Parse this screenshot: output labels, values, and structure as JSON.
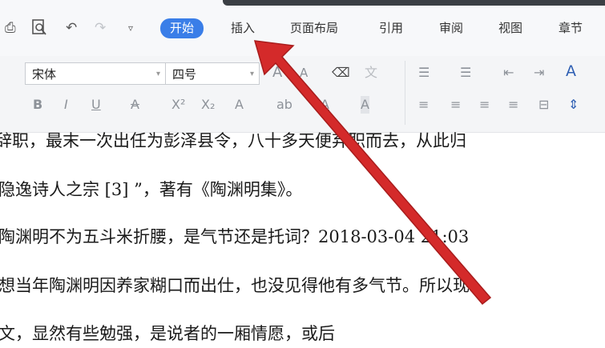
{
  "quick_access": {
    "print_icon": "printer-icon",
    "preview_icon": "print-preview-icon",
    "undo_icon": "undo-icon",
    "redo_icon": "redo-icon",
    "more_icon": "customize-icon"
  },
  "menu": {
    "tabs": [
      "开始",
      "插入",
      "页面布局",
      "引用",
      "审阅",
      "视图",
      "章节"
    ],
    "active_tab": "开始"
  },
  "ribbon": {
    "font_name": "宋体",
    "font_size": "四号",
    "format_buttons": [
      "B",
      "I",
      "U",
      "A",
      "X²",
      "X₂",
      "A",
      "ab",
      "A",
      "A"
    ],
    "grow_font": "A",
    "shrink_font": "A",
    "phonetic": "文",
    "style_a": "A"
  },
  "document": {
    "lines": [
      "辞职，最末一次出任为彭泽县令，八十多天便弃职而去，从此归",
      "隐逸诗人之宗 [3] ”，著有《陶渊明集》。",
      "陶渊明不为五斗米折腰，是气节还是托词？2018-03-04 21:03",
      "想当年陶渊明因养家糊口而出仕，也没见得他有多气节。所以现",
      "文，显然有些勉强，是说者的一厢情愿，或后"
    ]
  },
  "colors": {
    "accent": "#3a7ee8",
    "annotation_arrow": "#d42a2a"
  }
}
